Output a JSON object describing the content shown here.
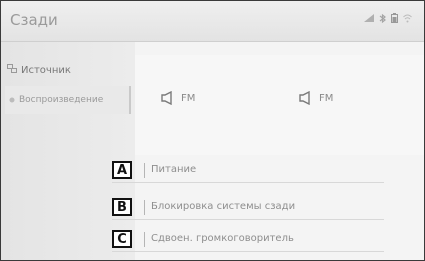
{
  "header": {
    "title": "Сзади",
    "status_icons": [
      "signal-icon",
      "bluetooth-icon",
      "battery-icon",
      "wifi-icon"
    ]
  },
  "sidebar": {
    "items": [
      {
        "label": "Источник",
        "icon": "source-icon"
      },
      {
        "label": "Воспроизведение",
        "icon": "play-dot-icon"
      }
    ]
  },
  "speakers": [
    {
      "label": "FM",
      "icon": "speaker-icon"
    },
    {
      "label": "FM",
      "icon": "speaker-icon"
    }
  ],
  "options": [
    {
      "badge": "A",
      "label": "Питание"
    },
    {
      "badge": "B",
      "label": "Блокировка системы сзади"
    },
    {
      "badge": "C",
      "label": "Сдвоен. громкоговоритель"
    }
  ]
}
